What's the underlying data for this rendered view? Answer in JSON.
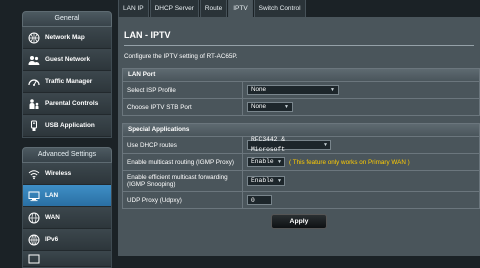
{
  "sidebar": {
    "general_header": "General",
    "general_items": [
      {
        "label": "Network Map",
        "icon": "network-map-icon"
      },
      {
        "label": "Guest Network",
        "icon": "guest-network-icon"
      },
      {
        "label": "Traffic Manager",
        "icon": "traffic-manager-icon"
      },
      {
        "label": "Parental Controls",
        "icon": "parental-controls-icon"
      },
      {
        "label": "USB Application",
        "icon": "usb-application-icon"
      }
    ],
    "advanced_header": "Advanced Settings",
    "advanced_items": [
      {
        "label": "Wireless",
        "icon": "wireless-icon"
      },
      {
        "label": "LAN",
        "icon": "lan-icon",
        "active": true
      },
      {
        "label": "WAN",
        "icon": "wan-icon"
      },
      {
        "label": "IPv6",
        "icon": "ipv6-icon"
      }
    ]
  },
  "tabs": [
    "LAN IP",
    "DHCP Server",
    "Route",
    "IPTV",
    "Switch Control"
  ],
  "active_tab": "IPTV",
  "page": {
    "title": "LAN - IPTV",
    "description": "Configure the IPTV setting of RT-AC65P."
  },
  "lan_port": {
    "header": "LAN Port",
    "rows": [
      {
        "label": "Select ISP Profile",
        "value": "None"
      },
      {
        "label": "Choose IPTV STB Port",
        "value": "None"
      }
    ]
  },
  "special": {
    "header": "Special Applications",
    "dhcp_label": "Use DHCP routes",
    "dhcp_value": "RFC3442 & Microsoft",
    "multicast_label": "Enable multicast routing (IGMP Proxy)",
    "multicast_value": "Enable",
    "multicast_note": "( This feature only works on Primary WAN )",
    "forwarding_label": "Enable efficient multicast forwarding (IGMP Snooping)",
    "forwarding_value": "Enable",
    "udpxy_label": "UDP Proxy (Udpxy)",
    "udpxy_value": "0"
  },
  "apply_label": "Apply"
}
